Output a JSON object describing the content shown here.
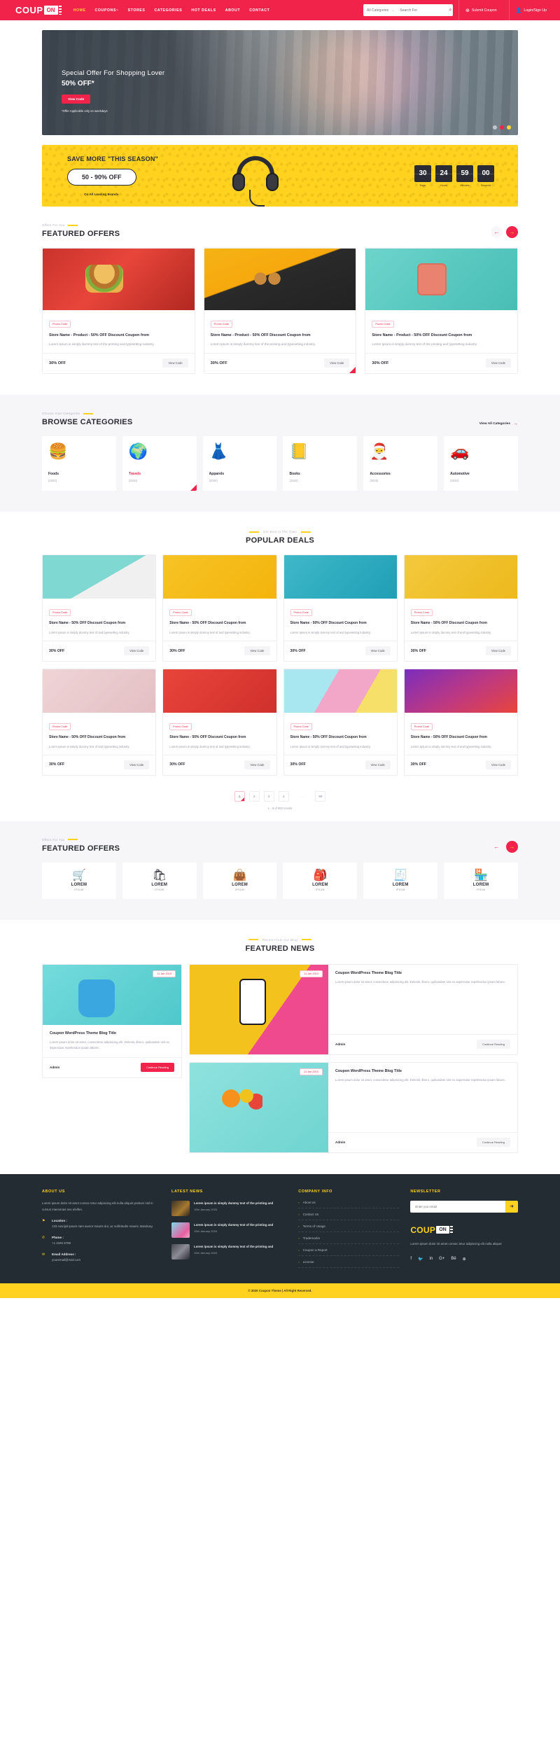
{
  "header": {
    "logo_main": "COUP",
    "logo_badge": "ON",
    "nav": [
      {
        "label": "HOME",
        "active": true
      },
      {
        "label": "COUPONS~",
        "active": false
      },
      {
        "label": "STORES",
        "active": false
      },
      {
        "label": "CATEGORIES",
        "active": false
      },
      {
        "label": "HOT DEALS",
        "active": false
      },
      {
        "label": "ABOUT",
        "active": false
      },
      {
        "label": "CONTACT",
        "active": false
      }
    ],
    "search": {
      "category_label": "All Categories",
      "caret": "chevron-down",
      "placeholder": "Search For",
      "value": "",
      "icon": "search-icon"
    },
    "submit_coupon": "Submit Coupon",
    "login": "Login/Sign Up"
  },
  "hero": {
    "title": "Special Offer For Shopping Lover",
    "subtitle": "50% OFF*",
    "button": "View Code",
    "note": "*Offer Applicable only on weekdays"
  },
  "season": {
    "heading": "SAVE MORE \"THIS SEASON\"",
    "pill": "50 - 90% OFF",
    "sub": "On All Leading Brands",
    "countdown": [
      {
        "value": "30",
        "label": "Days"
      },
      {
        "value": "24",
        "label": "Hours"
      },
      {
        "value": "59",
        "label": "Minutes"
      },
      {
        "value": "00",
        "label": "Seconds"
      }
    ]
  },
  "featured_offers": {
    "eyebrow": "Offers For You",
    "title": "FEATURED OFFERS",
    "cards": [
      {
        "badge": "Promo Code",
        "title": "Store Name - Product - 50% OFF Discount Coupon from",
        "desc": "Lorem Ipsum is simply dummy text of the printing and typesetting industry.",
        "off": "30% OFF",
        "button": "View Code"
      },
      {
        "badge": "Promo Code",
        "title": "Store Name - Product - 50% OFF Discount Coupon from",
        "desc": "Lorem Ipsum is simply dummy text of the printing and typesetting industry.",
        "off": "30% OFF",
        "button": "View Code"
      },
      {
        "badge": "Promo Code",
        "title": "Store Name - Product - 50% OFF Discount Coupon from",
        "desc": "Lorem Ipsum is simply dummy text of the printing and typesetting industry.",
        "off": "30% OFF",
        "button": "View Code"
      }
    ]
  },
  "categories": {
    "eyebrow": "Choose Your Categories",
    "title": "BROWSE CATEGORIES",
    "view_all": "View All Categories",
    "items": [
      {
        "icon": "🍔",
        "name": "Foods",
        "count": "(2020)",
        "active": false
      },
      {
        "icon": "🌍",
        "name": "Travels",
        "count": "(2020)",
        "active": true
      },
      {
        "icon": "👗",
        "name": "Apparels",
        "count": "(2020)",
        "active": false
      },
      {
        "icon": "📒",
        "name": "Books",
        "count": "(2020)",
        "active": false
      },
      {
        "icon": "🎅",
        "name": "Accessories",
        "count": "(2020)",
        "active": false
      },
      {
        "icon": "🚗",
        "name": "Automotive",
        "count": "(2020)",
        "active": false
      }
    ]
  },
  "popular_deals": {
    "eyebrow": "Get Best In The Town",
    "title": "POPULAR DEALS",
    "cards": [
      {
        "badge": "Promo Code",
        "title": "Store Name - 50% OFF Discount Coupon from",
        "desc": "Lorem Ipsum is simply dummy text of and typesetting industry.",
        "off": "30% OFF",
        "button": "View Code"
      },
      {
        "badge": "Promo Code",
        "title": "Store Name - 50% OFF Discount Coupon from",
        "desc": "Lorem Ipsum is simply dummy text of and typesetting industry.",
        "off": "30% OFF",
        "button": "View Code"
      },
      {
        "badge": "Promo Code",
        "title": "Store Name - 50% OFF Discount Coupon from",
        "desc": "Lorem Ipsum is simply dummy text of and typesetting industry.",
        "off": "30% OFF",
        "button": "View Code"
      },
      {
        "badge": "Promo Code",
        "title": "Store Name - 50% OFF Discount Coupon from",
        "desc": "Lorem Ipsum is simply dummy text of and typesetting industry.",
        "off": "30% OFF",
        "button": "View Code"
      },
      {
        "badge": "Promo Code",
        "title": "Store Name - 50% OFF Discount Coupon from",
        "desc": "Lorem Ipsum is simply dummy text of and typesetting industry.",
        "off": "30% OFF",
        "button": "View Code"
      },
      {
        "badge": "Promo Code",
        "title": "Store Name - 50% OFF Discount Coupon from",
        "desc": "Lorem Ipsum is simply dummy text of and typesetting industry.",
        "off": "30% OFF",
        "button": "View Code"
      },
      {
        "badge": "Promo Code",
        "title": "Store Name - 50% OFF Discount Coupon from",
        "desc": "Lorem Ipsum is simply dummy text of and typesetting industry.",
        "off": "30% OFF",
        "button": "View Code"
      },
      {
        "badge": "Promo Code",
        "title": "Store Name - 50% OFF Discount Coupon from",
        "desc": "Lorem Ipsum is simply dummy text of and typesetting industry.",
        "off": "30% OFF",
        "button": "View Code"
      }
    ],
    "pagination": [
      "1",
      "2",
      "3",
      "4",
      "......",
      "99"
    ],
    "current_page": "1",
    "results_text": "1 - 9 of  900 results"
  },
  "brands": {
    "eyebrow": "Offers For You",
    "title": "FEATURED OFFERS",
    "items": [
      {
        "icon": "🛒",
        "name": "LOREM",
        "sub": "IPSUM"
      },
      {
        "icon": "🛍",
        "name": "LOREM",
        "sub": "IPSUM"
      },
      {
        "icon": "👜",
        "name": "LOREM",
        "sub": "IPSUM"
      },
      {
        "icon": "🎒",
        "name": "LOREM",
        "sub": "IPSUM"
      },
      {
        "icon": "🧾",
        "name": "LOREM",
        "sub": "IPSUM"
      },
      {
        "icon": "🏪",
        "name": "LOREM",
        "sub": "IPSUM"
      }
    ]
  },
  "news": {
    "eyebrow": "Recent From Our Blog",
    "title": "FEATURED NEWS",
    "left_card": {
      "date": "11 Jan 2019",
      "title": "Coupon WordPress Theme Blog Title",
      "desc": "Lorem ipsum dolor sit amet, consectetur adipisicing elit. Deleniti, libero, quibusdam sint ex aspernatur repellendus ipsam labore..",
      "author": "Admin",
      "button": "Continue Reading"
    },
    "right_top": {
      "date": "11 Jan 2019",
      "title": "Coupon WordPress Theme Blog Title",
      "desc": "Lorem ipsum dolor sit amet, consectetur adipisicing elit. Deleniti, libero, quibusdam sint ex aspernatur repellendus ipsam labore..",
      "author": "Admin",
      "button": "Continue Reading"
    },
    "right_bottom": {
      "date": "11 Jan 2019",
      "title": "Coupon WordPress Theme Blog Title",
      "desc": "Lorem ipsum dolor sit amet, consectetur adipisicing elit. Deleniti, libero, quibusdam sint ex aspernatur repellendus ipsam labore..",
      "author": "Admin",
      "button": "Continue Reading"
    }
  },
  "footer": {
    "about": {
      "heading": "ABOUT US",
      "text": "Lorem ipsum dolor sit amet consec tetur adipiscing elit nulla aliquet pretium nisl in cursus maecenas nec eleifen.",
      "location_label": "Location :",
      "location_value": "123 suscipit ipsum nam auctor mauris dui, ac sollicitudin mauris, Bandung",
      "phone_label": "Phone :",
      "phone_value": "+1 2345 6789",
      "email_label": "Email Address :",
      "email_value": "youremail@mail.com"
    },
    "latest_news": {
      "heading": "LATEST NEWS",
      "items": [
        {
          "title": "Lorem ipsum is simply dummy text of the printing and",
          "date": "10th January 2020"
        },
        {
          "title": "Lorem ipsum is simply dummy text of the printing and",
          "date": "10th January 2020"
        },
        {
          "title": "Lorem ipsum is simply dummy text of the printing and",
          "date": "10th January 2020"
        }
      ]
    },
    "company_info": {
      "heading": "COMPANY INFO",
      "links": [
        "About us",
        "Contact Us",
        "Terms of Usage",
        "Trademarks",
        "Coupon a Report",
        "License"
      ]
    },
    "newsletter": {
      "heading": "NEWSLETTER",
      "placeholder": "Enter you email",
      "value": "",
      "submit_icon": "arrow-right-icon",
      "logo_main": "COUP",
      "logo_badge": "ON",
      "text": "Lorem ipsum dolor sit amet consec tetur adipiscing elit nulla aliquet",
      "socials": [
        "f",
        "🐦",
        "in",
        "G+",
        "Bē",
        "⊕"
      ]
    },
    "copyright": "© 2020 Coupon Theme | All Right Reserved."
  },
  "colors": {
    "brand_red": "#f2234b",
    "brand_yellow": "#ffd21f",
    "dark": "#222c32",
    "light_bg": "#f6f6f9"
  }
}
